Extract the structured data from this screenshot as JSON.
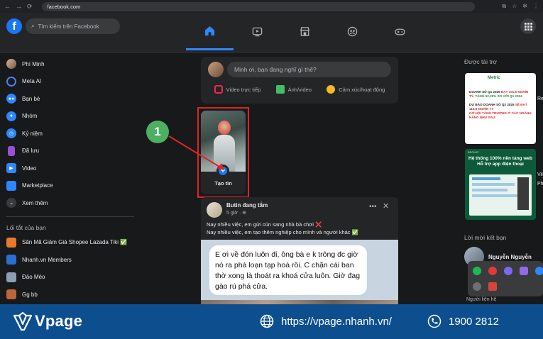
{
  "browser": {
    "url": "facebook.com"
  },
  "header": {
    "logo": "f",
    "search_placeholder": "Tìm kiếm trên Facebook"
  },
  "sidebar": {
    "items": [
      {
        "label": "Phí Minh",
        "icon": "avatar",
        "color": "#b48a6e"
      },
      {
        "label": "Meta AI",
        "icon": "meta-ai-icon",
        "color": "#4a7ef0"
      },
      {
        "label": "Bạn bè",
        "icon": "friends-icon",
        "color": "#2d88ff"
      },
      {
        "label": "Nhóm",
        "icon": "groups-icon",
        "color": "#2d88ff"
      },
      {
        "label": "Kỷ niệm",
        "icon": "memories-icon",
        "color": "#2d88ff"
      },
      {
        "label": "Đã lưu",
        "icon": "saved-icon",
        "color": "#9b4fd9"
      },
      {
        "label": "Video",
        "icon": "video-icon",
        "color": "#2d88ff"
      },
      {
        "label": "Marketplace",
        "icon": "marketplace-icon",
        "color": "#2d88ff"
      },
      {
        "label": "Xem thêm",
        "icon": "chevron-down-icon",
        "color": "#3a3b3c"
      }
    ],
    "shortcuts_title": "Lối tắt của bạn",
    "shortcuts": [
      {
        "label": "Săn Mã Giảm Giá Shopee Lazada Tiki ✅",
        "color": "#e87a2e"
      },
      {
        "label": "Nhanh.vn Members",
        "color": "#2a6fd1"
      },
      {
        "label": "Đảo Mèo",
        "color": "#8ca0b3"
      },
      {
        "label": "Gg bb",
        "color": "#c0643a"
      }
    ]
  },
  "composer": {
    "placeholder": "Minh ơi, bạn đang nghĩ gì thế?",
    "actions": [
      {
        "label": "Video trực tiếp",
        "color": "#f02849"
      },
      {
        "label": "Ảnh/video",
        "color": "#45bd62"
      },
      {
        "label": "Cảm xúc/hoạt động",
        "color": "#f7b928"
      }
    ]
  },
  "story": {
    "label": "Tạo tin",
    "plus": "+"
  },
  "annotation": {
    "step": "1"
  },
  "post": {
    "author": "Butin đang tắm",
    "time": "5 giờ · ",
    "line1": "Nay nhiều việc, em gửi cún sang nhà bà chơi ❌",
    "line2": "Nay nhiều việc, em tạo thêm nghiệp cho mình và người khác ✅",
    "bubble": "E ơi về đón luôn đi, ông bà e k trông đc giờ nó ra phá loạn tạp hoá rồi. C chặn cái ban thờ xong là thoát ra khoá cửa luôn. Giờ đag gào rú phá cửa."
  },
  "right": {
    "sponsored_title": "Được tài trợ",
    "ad1": {
      "brand": "Metric",
      "l1": "DOANH SỐ Q1 2025",
      "l1r": "ĐẠT 101,6 NGHÌN TỶ,",
      "l1g": "TĂNG 62,29% SO VỚI Q1 2024",
      "l2": "DỰ BÁO DOANH SỐ Q2 2025",
      "l2r": "SẼ ĐẠT 116,6 NGHÌN TỶ",
      "l3": "CƠ HỘI TĂNG TRƯỞNG Ở CÁC NGÀNH HÀNG NHƯ SAU:"
    },
    "ad2": {
      "tag": "BECKAT",
      "t1": "Hệ thống 100% nền tảng web",
      "t2": "Hỗ trợ app điện thoại"
    },
    "cut1": "Re",
    "cut2": "Vil",
    "cut3": "Ph",
    "friends_title": "Lời mời kết bạn",
    "friend_name": "Nguyễn Nguyễn",
    "contacts_cut": "Người liên hệ"
  },
  "banner": {
    "brand": "Vpage",
    "url": "https://vpage.nhanh.vn/",
    "phone": "1900 2812",
    "color": "#0d4e8f"
  }
}
